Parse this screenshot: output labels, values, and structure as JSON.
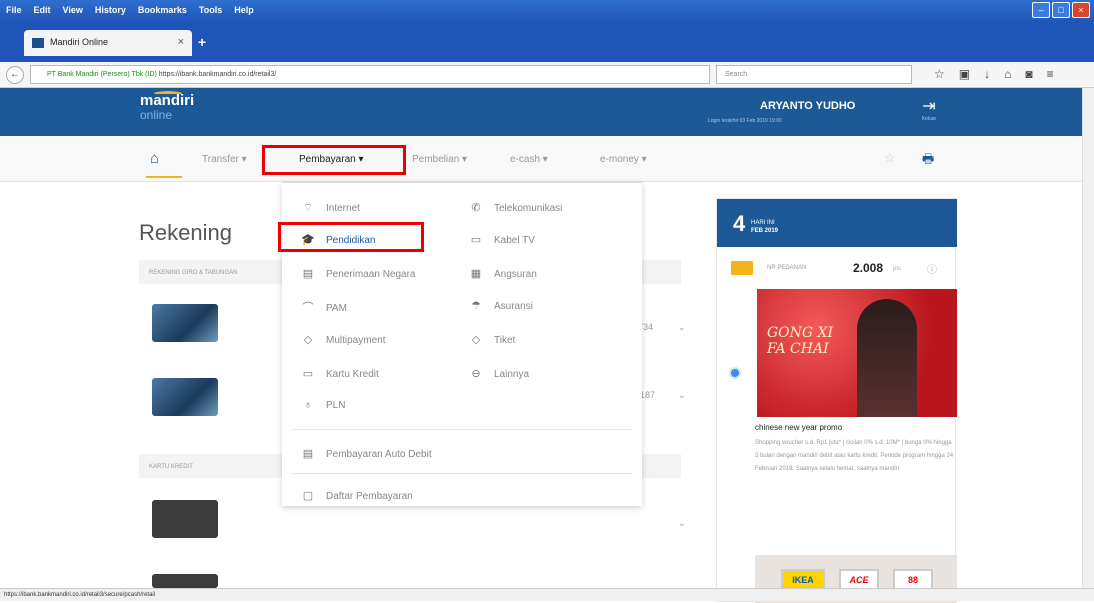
{
  "browser": {
    "menu": [
      "File",
      "Edit",
      "View",
      "History",
      "Bookmarks",
      "Tools",
      "Help"
    ],
    "tab_title": "Mandiri Online",
    "url_org": "PT Bank Mandiri (Persero) Tbk (ID)",
    "url": "https://ibank.bankmandiri.co.id/retail3/",
    "search_placeholder": "Search",
    "status_url": "https://ibank.bankmandiri.co.id/retail3/secure/pcash/retail"
  },
  "header": {
    "logo": "mandiri",
    "logo_sub": "online",
    "user_name": "ARYANTO YUDHO",
    "last_login": "Login terakhir 03 Feb 2019 19:00",
    "logout_label": "Keluar"
  },
  "nav": {
    "items": [
      "Transfer",
      "Pembayaran",
      "Pembelian",
      "e-cash",
      "e-money"
    ]
  },
  "main": {
    "title": "Rekening",
    "section1": "REKENING GIRO & TABUNGAN",
    "section2": "KARTU KREDIT",
    "row1_val": "734",
    "row2_val": "187"
  },
  "dropdown": {
    "left": [
      "Internet",
      "Pendidikan",
      "Penerimaan Negara",
      "PAM",
      "Multipayment",
      "Kartu Kredit",
      "PLN"
    ],
    "right": [
      "Telekomunikasi",
      "Kabel TV",
      "Angsuran",
      "Asuransi",
      "Tiket",
      "Lainnya"
    ],
    "auto_debit": "Pembayaran Auto Debit",
    "daftar": "Daftar Pembayaran"
  },
  "promo": {
    "day": "4",
    "day_name": "HARI INI",
    "month_year": "FEB 2019",
    "ticker_label": "NR PEDANAN",
    "ticker_value": "2.008",
    "ticker_unit": "pts",
    "image_text_1": "GONG XI",
    "image_text_2": "FA CHAI",
    "title": "chinese new year promo",
    "text": "Shopping voucher s.d. Rp1 juta* | cicilan 0% s.d. 10M* | bunga 0% hingga 3 bulan dengan mandiri debit atau kartu kredit. Periode program hingga 24 Februari 2019. Saatnya selalu hemat, saatnya mandiri",
    "logos": [
      "IKEA",
      "ACE",
      "88"
    ]
  }
}
